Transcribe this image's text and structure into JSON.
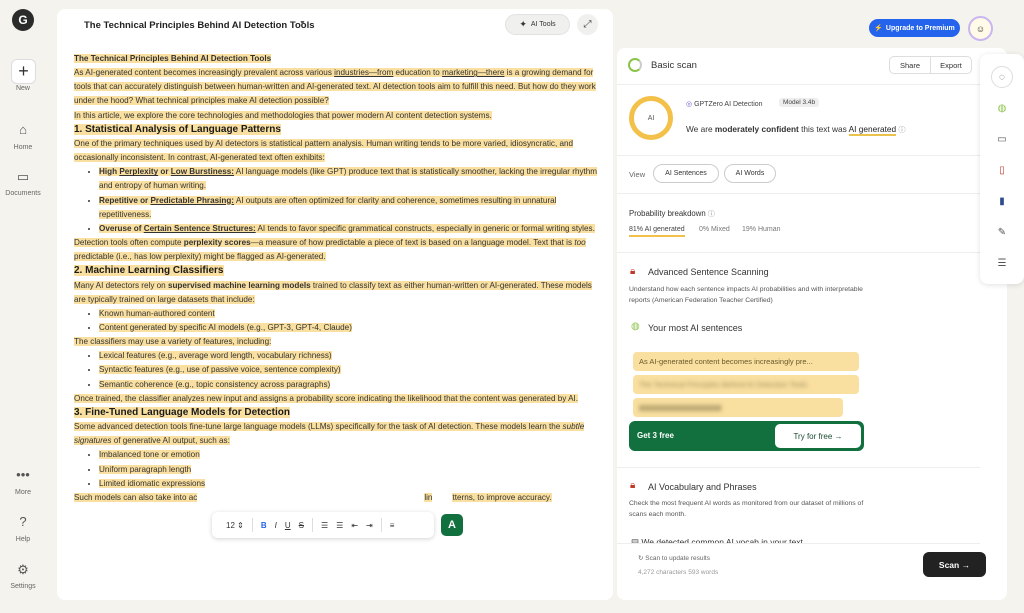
{
  "rail": {
    "logo": "G",
    "new_label": "New",
    "home_label": "Home",
    "documents_label": "Documents",
    "more_label": "More",
    "help_label": "Help",
    "settings_label": "Settings"
  },
  "editor": {
    "title": "The Technical Principles Behind AI Detection Tools",
    "ai_tools_label": "AI Tools",
    "body": {
      "doc_title": "The Technical Principles Behind AI Detection Tools",
      "intro1_a": "As AI-generated content becomes increasingly prevalent across various ",
      "intro1_b": "industries—from",
      "intro1_c": " education to ",
      "intro1_d": "marketing—there",
      "intro1_e": " is a growing demand for tools that can accurately distinguish between human-written and AI-generated text. AI detection tools aim to fulfill this need. But how do they work under the hood? What technical principles make AI detection possible?",
      "intro2": "In this article, we explore the core technologies and methodologies that power modern AI content detection systems.",
      "h1": "1. Statistical Analysis of Language Patterns",
      "s1_p1_a": "One of the primary techniques used by AI detectors is statistical pattern analysis. Human writing tends to be more varied, idiosyncratic, and occasionally inconsistent. ",
      "s1_p1_b": "In contrast, AI-generated text often exhibits:",
      "b1_title_a": "High ",
      "b1_title_b": "Perplexity",
      "b1_title_c": " or ",
      "b1_title_d": "Low Burstiness:",
      "b1_text": " AI language models (like GPT) produce text that is statistically smoother, lacking the irregular rhythm and entropy of human writing.",
      "b2_title_a": "Repetitive or ",
      "b2_title_b": "Predictable Phrasing:",
      "b2_text": " AI outputs are often optimized for clarity and coherence, sometimes resulting in unnatural repetitiveness.",
      "b3_title_a": "Overuse of ",
      "b3_title_b": "Certain Sentence Structures:",
      "b3_text": " AI tends to favor specific grammatical constructs, especially in generic or formal writing styles.",
      "s1_p2_a": "Detection tools often compute ",
      "s1_p2_b": "perplexity scores",
      "s1_p2_c": "—a measure of how predictable a piece of text is based on a language model. Text that is ",
      "s1_p2_d": "too",
      "s1_p2_e": " predictable (i.e., has low perplexity) might be flagged as AI-generated.",
      "h2": "2. Machine Learning Classifiers",
      "s2_p1_a": "Many AI detectors rely on ",
      "s2_p1_b": "supervised machine learning models",
      "s2_p1_c": " trained to classify text as either human-written or AI-generated. These models are typically trained on large datasets that include:",
      "s2_l1": "Known human-authored content",
      "s2_l2": "Content generated by specific AI models (e.g., GPT-3, GPT-4, Claude)",
      "s2_p2": "The classifiers may use a variety of features, including:",
      "s2_l3": "Lexical features (e.g., average word length, vocabulary richness)",
      "s2_l4": "Syntactic features (e.g., use of passive voice, sentence complexity)",
      "s2_l5": "Semantic coherence (e.g., topic consistency across paragraphs)",
      "s2_p3": "Once trained, the classifier analyzes new input and assigns a probability score indicating the likelihood that the content was generated by AI.",
      "h3": "3. Fine-Tuned Language Models for Detection",
      "s3_p1_a": "Some advanced detection tools fine-tune large language models (LLMs) specifically for the task of AI detection. These models learn the ",
      "s3_p1_b": "subtle signatures",
      "s3_p1_c": " of generative AI output, such as:",
      "s3_l1": "Imbalanced tone or emotion",
      "s3_l2": "Uniform paragraph length",
      "s3_l3": "Limited idiomatic expressions",
      "s3_p2_a": "Such models can also take into ac",
      "s3_p2_b": "lin",
      "s3_p2_c": "tterns, to improve accuracy."
    }
  },
  "format_toolbar": {
    "font_size": "12",
    "bold": "B",
    "italic": "I",
    "underline": "U",
    "strike": "S",
    "green_button": "A"
  },
  "header": {
    "upgrade_label": "Upgrade to Premium"
  },
  "scan": {
    "title": "Basic scan",
    "share_label": "Share",
    "export_label": "Export",
    "ring_label": "AI",
    "detector_name": "GPTZero AI Detection",
    "model_badge": "Model 3.4b",
    "verdict_a": "We are ",
    "verdict_b": "moderately confident",
    "verdict_c": " this text was ",
    "verdict_d": "AI generated",
    "view_label": "View",
    "ai_sentences_label": "AI Sentences",
    "ai_words_label": "AI Words",
    "prob_title": "Probability breakdown",
    "prob_ai": "81% AI generated",
    "prob_mixed": "0% Mixed",
    "prob_human": "19% Human",
    "prob_ai_fraction": 0.81,
    "adv_title": "Advanced Sentence Scanning",
    "adv_desc": "Understand how each sentence impacts AI probabilities and with interpretable reports (American Federation Teacher Certified)",
    "most_ai_title": "Your most AI sentences",
    "sentence1": "As AI-generated content becomes increasingly pre...",
    "sentence2": "The Technical Principles Behind AI Detection Tools",
    "get_free_label": "Get 3 free",
    "try_free_label": "Try for free →",
    "vocab_title": "AI Vocabulary and Phrases",
    "vocab_desc": "Check the most frequent AI words as monitored from our dataset of millions of scans each month.",
    "detected_title": "We detected common AI vocab in your text",
    "rescan_label": "Scan to update results",
    "counts_label": "4,272 characters 593 words",
    "scan_button_label": "Scan →"
  },
  "colors": {
    "highlight": "#f9dfa0",
    "accent_green": "#12703f",
    "upgrade_blue": "#2463eb",
    "ring_yellow": "#f3c04a"
  }
}
